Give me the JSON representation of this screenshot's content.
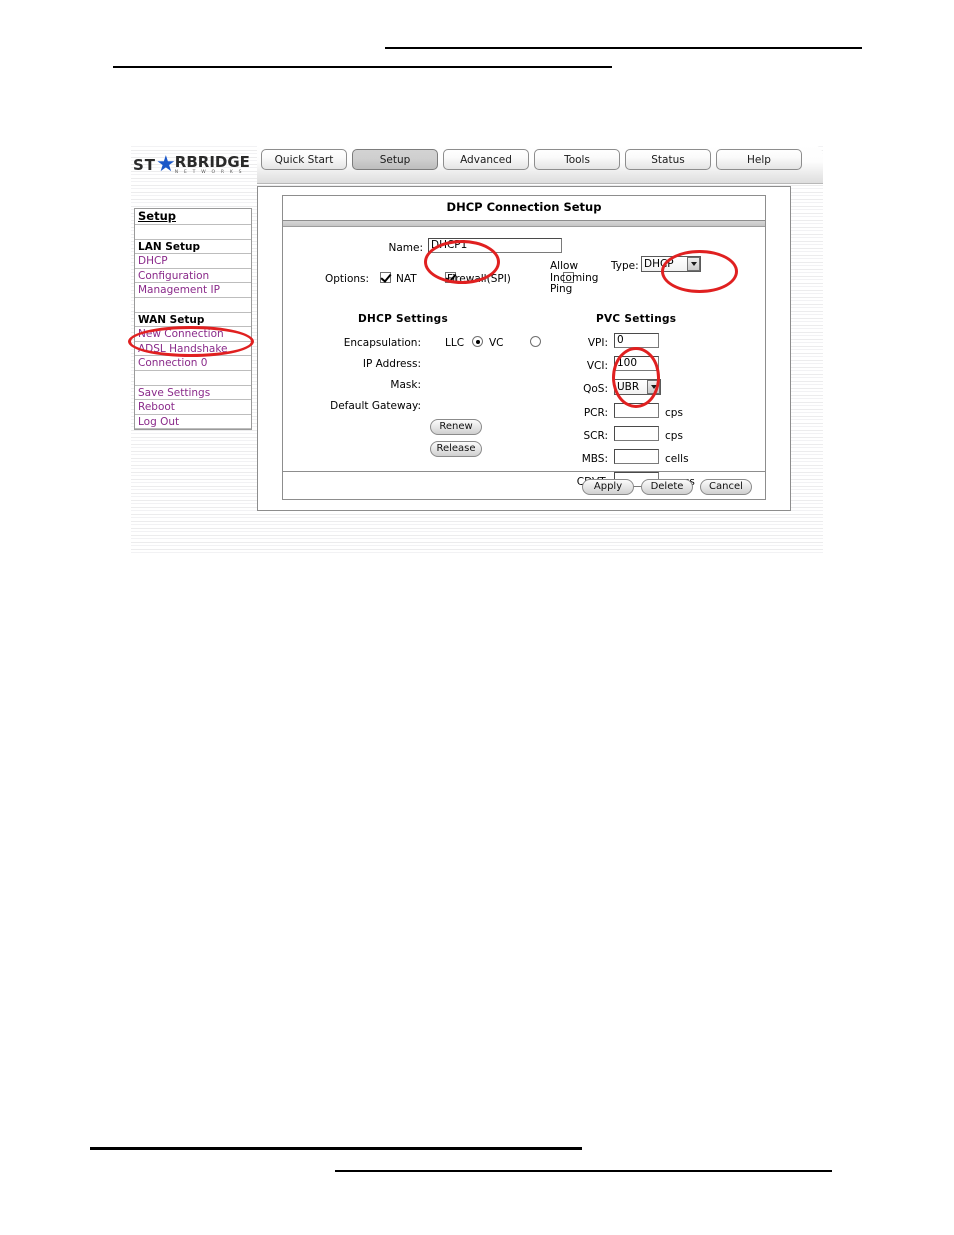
{
  "window": {
    "logo": {
      "part1": "ST",
      "star": "★",
      "part2": "RBRIDGE",
      "subtitle": "N E T W O R K S"
    },
    "tabs": [
      {
        "label": "Quick Start",
        "active": false
      },
      {
        "label": "Setup",
        "active": true
      },
      {
        "label": "Advanced",
        "active": false
      },
      {
        "label": "Tools",
        "active": false
      },
      {
        "label": "Status",
        "active": false
      },
      {
        "label": "Help",
        "active": false
      }
    ]
  },
  "sidebar": {
    "title": "Setup",
    "groups": [
      {
        "heading": "LAN Setup",
        "items": [
          "DHCP",
          "Configuration",
          "Management IP"
        ]
      },
      {
        "heading": "WAN Setup",
        "items": [
          "New Connection",
          "ADSL Handshake",
          "Connection 0"
        ]
      }
    ],
    "actions": [
      "Save Settings",
      "Reboot",
      "Log Out"
    ]
  },
  "panel": {
    "title": "DHCP Connection Setup",
    "name": {
      "label": "Name:",
      "value": "DHCP1"
    },
    "options": {
      "label": "Options:",
      "items": [
        {
          "label": "NAT",
          "checked": true
        },
        {
          "label": "Firewall(SPI)",
          "checked": true
        },
        {
          "label": "Allow Incoming Ping",
          "checked": false
        }
      ]
    },
    "type": {
      "label": "Type:",
      "value": "DHCP"
    },
    "dhcp_settings": {
      "heading": "DHCP Settings",
      "encapsulation": {
        "label": "Encapsulation:",
        "options": [
          {
            "label": "LLC",
            "selected": true
          },
          {
            "label": "VC",
            "selected": false
          }
        ]
      },
      "fields": [
        {
          "label": "IP Address:",
          "value": ""
        },
        {
          "label": "Mask:",
          "value": ""
        },
        {
          "label": "Default Gateway:",
          "value": ""
        }
      ],
      "buttons": [
        "Renew",
        "Release"
      ]
    },
    "pvc_settings": {
      "heading": "PVC Settings",
      "rows": [
        {
          "label": "VPI:",
          "value": "0",
          "unit": "",
          "kind": "text"
        },
        {
          "label": "VCI:",
          "value": "100",
          "unit": "",
          "kind": "text"
        },
        {
          "label": "QoS:",
          "value": "UBR",
          "unit": "",
          "kind": "select"
        },
        {
          "label": "PCR:",
          "value": "",
          "unit": "cps",
          "kind": "text"
        },
        {
          "label": "SCR:",
          "value": "",
          "unit": "cps",
          "kind": "text"
        },
        {
          "label": "MBS:",
          "value": "",
          "unit": "cells",
          "kind": "text"
        },
        {
          "label": "CDVT:",
          "value": "",
          "unit": "usecs",
          "kind": "text"
        }
      ]
    },
    "footer_buttons": [
      "Apply",
      "Delete",
      "Cancel"
    ]
  },
  "annotations": {
    "color": "#e02020",
    "items": [
      "new-connection-link",
      "name-field",
      "type-dropdown",
      "vpi-vci-fields"
    ]
  }
}
